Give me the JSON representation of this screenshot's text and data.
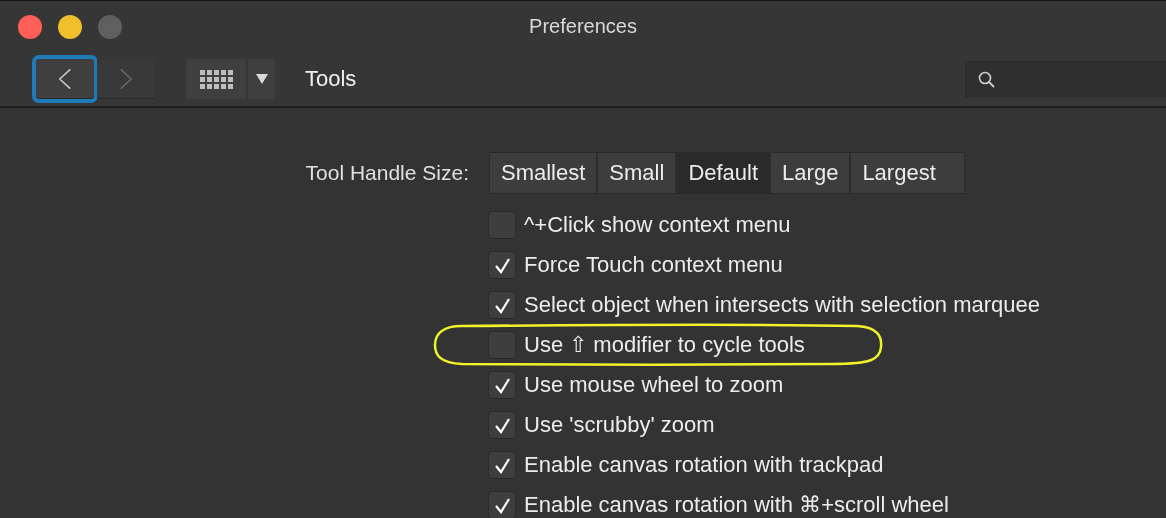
{
  "window": {
    "title": "Preferences"
  },
  "window_controls": [
    {
      "kind": "close",
      "disabled": false
    },
    {
      "kind": "minimize",
      "disabled": false
    },
    {
      "kind": "zoom",
      "disabled": true
    }
  ],
  "toolbar": {
    "nav_buttons": [
      {
        "kind": "back",
        "focused": true,
        "disabled": false
      },
      {
        "kind": "forward",
        "focused": false,
        "disabled": true
      }
    ],
    "section_title": "Tools"
  },
  "tool_handle_size": {
    "label": "Tool Handle Size:",
    "options": [
      {
        "label": "Smallest",
        "selected": false
      },
      {
        "label": "Small",
        "selected": false
      },
      {
        "label": "Default",
        "selected": true
      },
      {
        "label": "Large",
        "selected": false
      },
      {
        "label": "Largest",
        "selected": false
      }
    ]
  },
  "options": [
    {
      "label": "^+Click show context menu",
      "checked": false
    },
    {
      "label": "Force Touch context menu",
      "checked": true
    },
    {
      "label": "Select object when intersects with selection marquee",
      "checked": true
    },
    {
      "label": "Use ⇧ modifier to cycle tools",
      "checked": false
    },
    {
      "label": "Use mouse wheel to zoom",
      "checked": true
    },
    {
      "label": "Use 'scrubby' zoom",
      "checked": true
    },
    {
      "label": "Enable canvas rotation with trackpad",
      "checked": true
    },
    {
      "label": "Enable canvas rotation with ⌘+scroll wheel",
      "checked": true
    }
  ],
  "annotation": {
    "kind": "freehand-loop"
  }
}
